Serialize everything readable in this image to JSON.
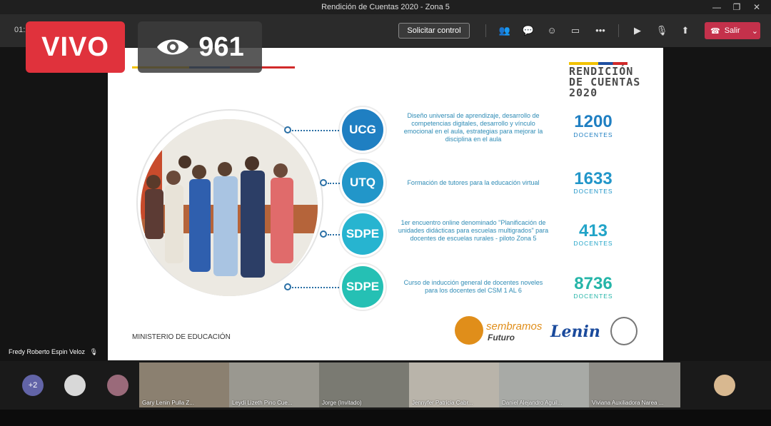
{
  "window": {
    "title": "Rendición de Cuentas 2020 - Zona 5",
    "controls": [
      "—",
      "❐",
      "✕"
    ]
  },
  "toolbar": {
    "time": "01:2",
    "request_control": "Solicitar control",
    "leave": "Salir",
    "icons": [
      "participants-icon",
      "chat-icon",
      "reactions-icon",
      "rooms-icon",
      "more-icon",
      "camera-off-icon",
      "mic-off-icon",
      "share-icon"
    ]
  },
  "live": {
    "label": "VIVO",
    "viewers": "961"
  },
  "slide": {
    "title_lines": [
      "RENDICIÓN",
      "DE CUENTAS",
      "2020"
    ],
    "ministry": "MINISTERIO DE EDUCACIÓN",
    "rows": [
      {
        "badge": "UCG",
        "color": "#1f7fc2",
        "text": "Diseño universal de aprendizaje, desarrollo de competencias digitales, desarrollo y vínculo emocional en el aula, estrategias para mejorar la disciplina en el aula",
        "number": "1200",
        "unit": "DOCENTES",
        "num_color": "#1f7fc2"
      },
      {
        "badge": "UTQ",
        "color": "#2296c9",
        "text": "Formación de tutores para la educación virtual",
        "number": "1633",
        "unit": "DOCENTES",
        "num_color": "#2296c9"
      },
      {
        "badge": "SDPE",
        "color": "#27b4d0",
        "text": "1er encuentro online denominado \"Planificación de unidades didácticas para escuelas multigrados\" para docentes de escuelas rurales - piloto Zona 5",
        "number": "413",
        "unit": "DOCENTES",
        "num_color": "#22a4c8"
      },
      {
        "badge": "SDPE",
        "color": "#25c0b4",
        "text": "Curso de inducción general de docentes noveles para los docentes del CSM 1 AL 6",
        "number": "8736",
        "unit": "DOCENTES",
        "num_color": "#25b5a8"
      }
    ],
    "logos": {
      "sembramos": "sembramos",
      "futuro": "Futuro",
      "lenin": "Lenin"
    }
  },
  "presenter": "Fredy Roberto Espin Veloz",
  "participants": {
    "overflow": "+2",
    "tiles": [
      "Gary Lenin Pulla Z...",
      "Leydi Lizeth Pino Cue...",
      "Jorge (Invitado)",
      "Jennyfer Patricia Cabr...",
      "Daniel Alejandro Aguil...",
      "Viviana Auxiliadora Narea ..."
    ]
  }
}
